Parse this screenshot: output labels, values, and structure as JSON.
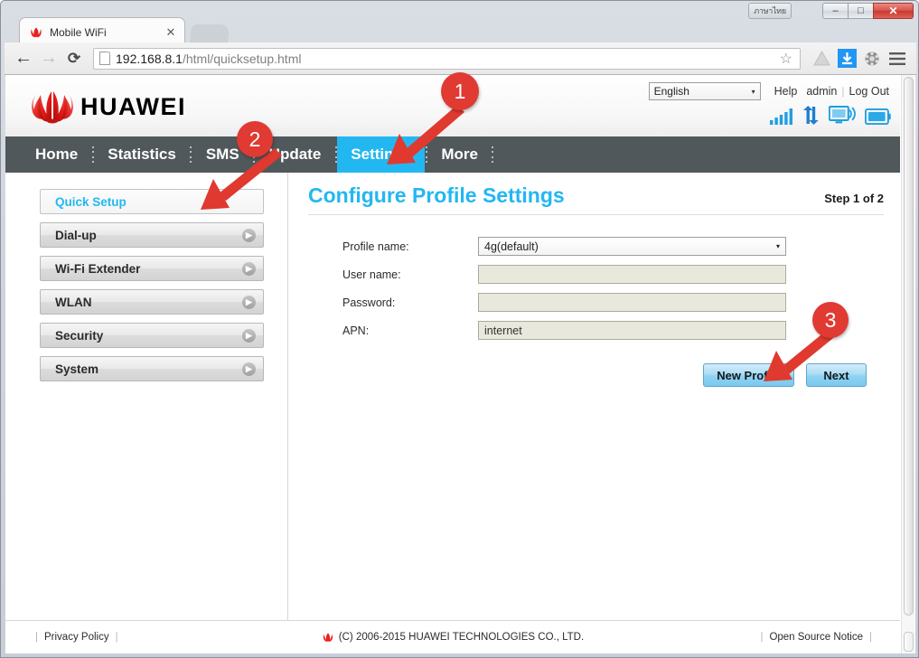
{
  "window": {
    "lang_indicator": "ภาษาไทย",
    "minimize_label": "–",
    "maximize_label": "□",
    "close_label": "✕"
  },
  "browser": {
    "tab": {
      "title": "Mobile WiFi",
      "close_label": "✕",
      "favicon": "huawei-favicon"
    },
    "back_label": "←",
    "forward_label": "→",
    "reload_label": "⟳",
    "url_host": "192.168.8.1",
    "url_path": "/html/quicksetup.html",
    "star_label": "☆",
    "extensions": [
      "drive-icon",
      "download-icon",
      "camera-icon"
    ],
    "menu_label": "≡"
  },
  "header": {
    "brand": "HUAWEI",
    "language": "English",
    "language_caret": "▾",
    "links": [
      "Help",
      "admin",
      "Log Out"
    ],
    "status_icons": [
      "signal-bars-icon",
      "data-transfer-icon",
      "wifi-monitor-icon",
      "battery-icon"
    ]
  },
  "nav": {
    "items": [
      {
        "label": "Home",
        "active": false
      },
      {
        "label": "Statistics",
        "active": false
      },
      {
        "label": "SMS",
        "active": false
      },
      {
        "label": "Update",
        "active": false
      },
      {
        "label": "Settings",
        "active": true
      },
      {
        "label": "More",
        "active": false
      }
    ]
  },
  "sidebar": {
    "items": [
      {
        "label": "Quick Setup",
        "active": true,
        "arrow": false
      },
      {
        "label": "Dial-up",
        "active": false,
        "arrow": true
      },
      {
        "label": "Wi-Fi Extender",
        "active": false,
        "arrow": true
      },
      {
        "label": "WLAN",
        "active": false,
        "arrow": true
      },
      {
        "label": "Security",
        "active": false,
        "arrow": true
      },
      {
        "label": "System",
        "active": false,
        "arrow": true
      }
    ],
    "arrow_glyph": "▶"
  },
  "content": {
    "title": "Configure Profile Settings",
    "step": "Step 1 of 2",
    "fields": [
      {
        "label": "Profile name:",
        "type": "select",
        "value": "4g(default)",
        "caret": "▾"
      },
      {
        "label": "User name:",
        "type": "input",
        "value": ""
      },
      {
        "label": "Password:",
        "type": "input",
        "value": ""
      },
      {
        "label": "APN:",
        "type": "input",
        "value": "internet"
      }
    ],
    "buttons": [
      {
        "label": "New Profile",
        "wide": true
      },
      {
        "label": "Next",
        "wide": false
      }
    ]
  },
  "footer": {
    "privacy": "Privacy Policy",
    "copyright": "(C) 2006-2015 HUAWEI TECHNOLOGIES CO., LTD.",
    "open_source": "Open Source Notice"
  },
  "annotations": [
    {
      "number": "1",
      "target": "settings-nav-tab"
    },
    {
      "number": "2",
      "target": "quick-setup-sidebar-item"
    },
    {
      "number": "3",
      "target": "new-profile-button"
    }
  ],
  "colors": {
    "accent": "#23b7f1",
    "nav_bg": "#50585b",
    "annotation": "#e03a32",
    "brand_red": "#e8221f",
    "input_bg": "#e9e8dd"
  }
}
